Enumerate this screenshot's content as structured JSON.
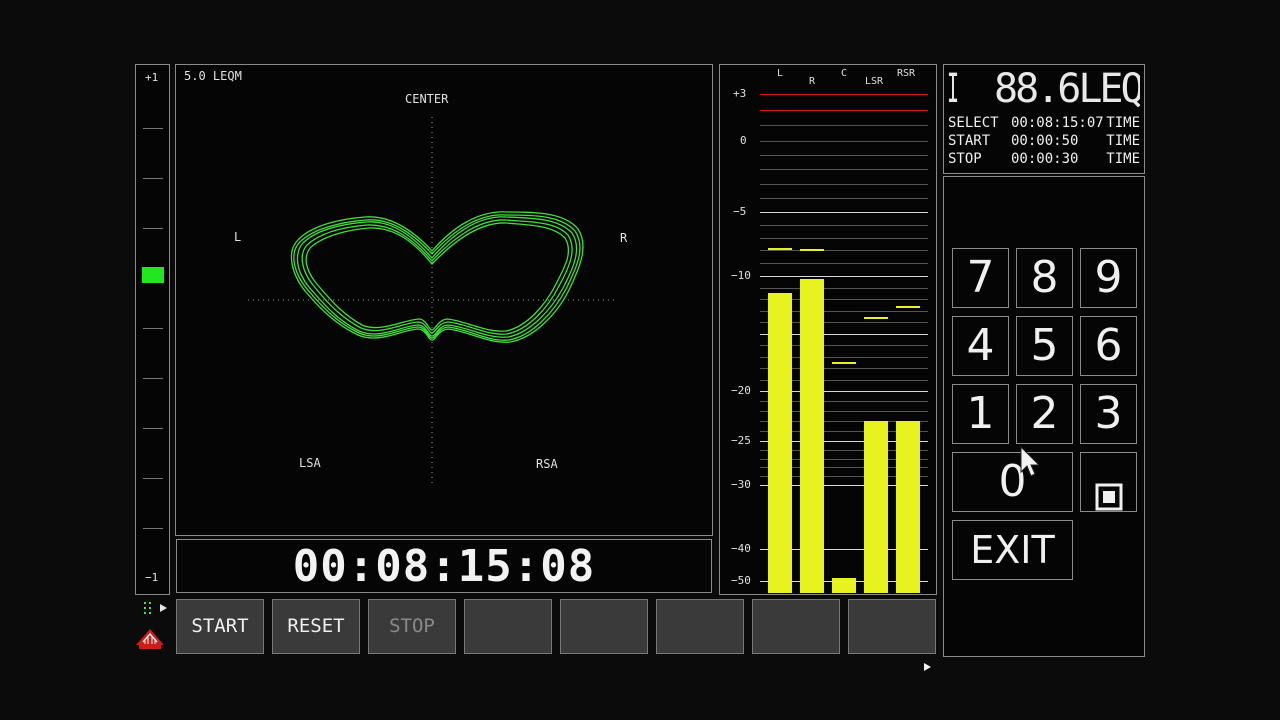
{
  "left_meter": {
    "top_label": "+1",
    "bottom_label": "−1",
    "level": 0.38,
    "indicator_color": "#22e61f"
  },
  "scope": {
    "mode_label": "5.0 LEQM",
    "center_label": "CENTER",
    "left_label": "L",
    "right_label": "R",
    "ls_label": "LSA",
    "rs_label": "RSA",
    "trace_color": "#3fe03a"
  },
  "timecode": "00:08:15:08",
  "function_buttons": {
    "start": "START",
    "reset": "RESET",
    "stop": "STOP"
  },
  "level_meter": {
    "channels": [
      "L",
      "R",
      "C",
      "LSR",
      "RSR"
    ],
    "scale_labels": [
      "+3",
      "0",
      "−5",
      "−10",
      "−20",
      "−25",
      "−30",
      "−40",
      "−50"
    ],
    "bar_color": "#e8f21e",
    "levels_db": [
      -11.5,
      -10.3,
      -49,
      -23,
      -23
    ],
    "peaks_db": [
      -7.8,
      -7.9,
      -17.5,
      -13.6,
      -12.6
    ]
  },
  "readout": {
    "mode_indicator": "I",
    "value": "88.6",
    "unit": "LEQM",
    "rows": [
      {
        "label": "SELECT",
        "time": "00:08:15:07",
        "suffix": "TIME"
      },
      {
        "label": "START",
        "time": "00:00:50",
        "suffix": "TIME"
      },
      {
        "label": "STOP",
        "time": "00:00:30",
        "suffix": "TIME"
      }
    ]
  },
  "keypad": {
    "keys": [
      "7",
      "8",
      "9",
      "4",
      "5",
      "6",
      "1",
      "2",
      "3",
      "0"
    ],
    "exit_label": "EXIT"
  }
}
